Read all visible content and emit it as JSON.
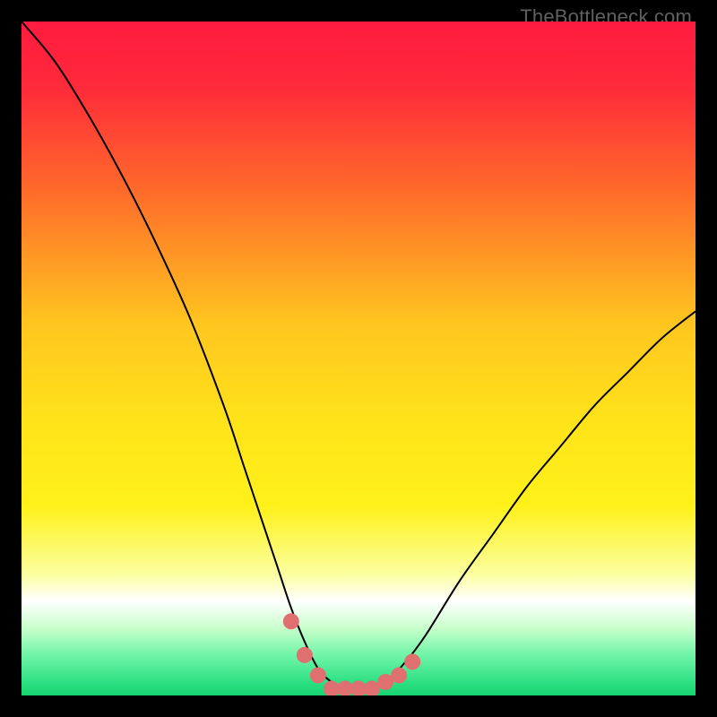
{
  "watermark": "TheBottleneck.com",
  "chart_data": {
    "type": "line",
    "title": "",
    "xlabel": "",
    "ylabel": "",
    "xlim": [
      0,
      100
    ],
    "ylim": [
      0,
      100
    ],
    "grid": false,
    "background_gradient": {
      "stops": [
        {
          "offset": 0.0,
          "color": "#ff1a3f"
        },
        {
          "offset": 0.1,
          "color": "#ff2b3a"
        },
        {
          "offset": 0.25,
          "color": "#ff6a2a"
        },
        {
          "offset": 0.45,
          "color": "#ffc61f"
        },
        {
          "offset": 0.6,
          "color": "#ffe41a"
        },
        {
          "offset": 0.72,
          "color": "#fff11a"
        },
        {
          "offset": 0.82,
          "color": "#fbffa0"
        },
        {
          "offset": 0.86,
          "color": "#ffffff"
        },
        {
          "offset": 0.9,
          "color": "#c8ffcc"
        },
        {
          "offset": 0.94,
          "color": "#70f5a8"
        },
        {
          "offset": 0.98,
          "color": "#2ee083"
        },
        {
          "offset": 1.0,
          "color": "#17d46e"
        }
      ]
    },
    "series": [
      {
        "name": "bottleneck-curve",
        "type": "line",
        "color": "#000000",
        "stroke_width": 2,
        "x": [
          0,
          5,
          10,
          15,
          20,
          25,
          30,
          33,
          36,
          38,
          40,
          42,
          44,
          46,
          48,
          50,
          52,
          54,
          57,
          60,
          65,
          70,
          75,
          80,
          85,
          90,
          95,
          100
        ],
        "y": [
          100,
          94,
          86,
          77,
          67,
          56,
          43,
          34,
          25,
          19,
          13,
          8,
          4,
          2,
          1,
          1,
          1,
          2,
          5,
          9,
          17,
          24,
          31,
          37,
          43,
          48,
          53,
          57
        ]
      },
      {
        "name": "highlight-points",
        "type": "scatter",
        "color": "#e07070",
        "marker_radius": 9,
        "x": [
          40,
          42,
          44,
          46,
          48,
          50,
          52,
          54,
          56,
          58
        ],
        "y": [
          11,
          6,
          3,
          1,
          1,
          1,
          1,
          2,
          3,
          5
        ]
      }
    ]
  }
}
